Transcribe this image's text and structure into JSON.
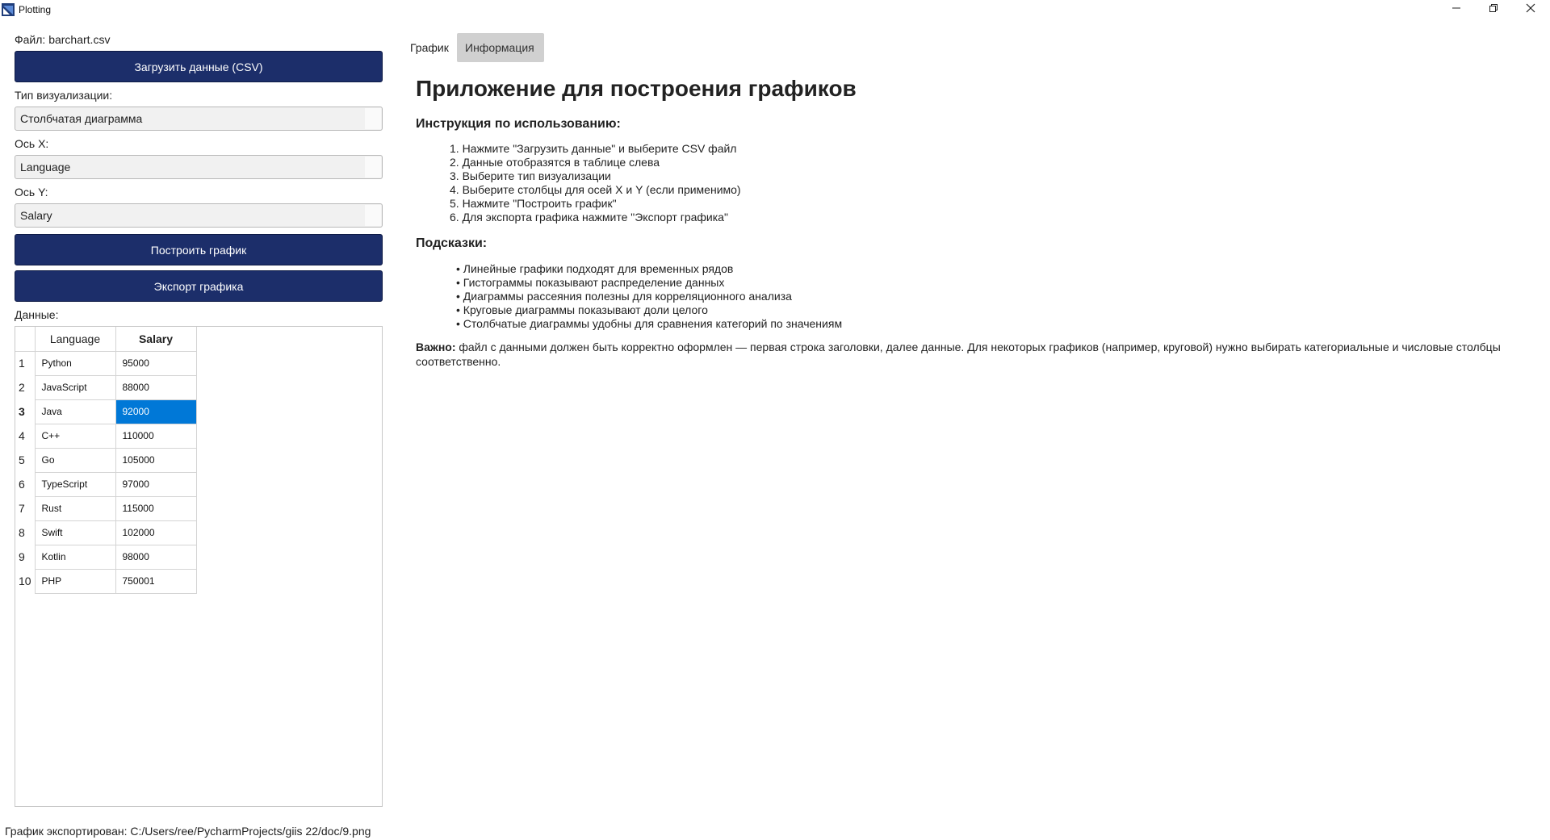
{
  "window": {
    "title": "Plotting"
  },
  "left": {
    "file_label": "Файл: barchart.csv",
    "load_button": "Загрузить данные (CSV)",
    "vis_type_label": "Тип визуализации:",
    "vis_type_value": "Столбчатая диаграмма",
    "x_axis_label": "Ось X:",
    "x_axis_value": "Language",
    "y_axis_label": "Ось Y:",
    "y_axis_value": "Salary",
    "plot_button": "Построить график",
    "export_button": "Экспорт графика",
    "data_label": "Данные:"
  },
  "table": {
    "columns": [
      "Language",
      "Salary"
    ],
    "rows": [
      {
        "n": "1",
        "language": "Python",
        "salary": "95000"
      },
      {
        "n": "2",
        "language": "JavaScript",
        "salary": "88000"
      },
      {
        "n": "3",
        "language": "Java",
        "salary": "92000"
      },
      {
        "n": "4",
        "language": "C++",
        "salary": "110000"
      },
      {
        "n": "5",
        "language": "Go",
        "salary": "105000"
      },
      {
        "n": "6",
        "language": "TypeScript",
        "salary": "97000"
      },
      {
        "n": "7",
        "language": "Rust",
        "salary": "115000"
      },
      {
        "n": "8",
        "language": "Swift",
        "salary": "102000"
      },
      {
        "n": "9",
        "language": "Kotlin",
        "salary": "98000"
      },
      {
        "n": "10",
        "language": "PHP",
        "salary": "750001"
      }
    ],
    "selected_row": 3
  },
  "status": "График экспортирован: C:/Users/ree/PycharmProjects/giis 22/doc/9.png",
  "tabs": {
    "graph": "График",
    "info": "Информация"
  },
  "info": {
    "title": "Приложение для построения графиков",
    "instructions_heading": "Инструкция по использованию:",
    "instructions": [
      "1. Нажмите \"Загрузить данные\" и выберите CSV файл",
      "2. Данные отобразятся в таблице слева",
      "3. Выберите тип визуализации",
      "4. Выберите столбцы для осей X и Y (если применимо)",
      "5. Нажмите \"Построить график\"",
      "6. Для экспорта графика нажмите \"Экспорт графика\""
    ],
    "tips_heading": "Подсказки:",
    "tips": [
      "• Линейные графики подходят для временных рядов",
      "• Гистограммы показывают распределение данных",
      "• Диаграммы рассеяния полезны для корреляционного анализа",
      "• Круговые диаграммы показывают доли целого",
      "• Столбчатые диаграммы удобны для сравнения категорий по значениям"
    ],
    "note_bold": "Важно:",
    "note_text": " файл с данными должен быть корректно оформлен — первая строка заголовки, далее данные. Для некоторых графиков (например, круговой) нужно выбирать категориальные и числовые столбцы соответственно."
  },
  "colors": {
    "primary_button": "#1c2e6a",
    "selection": "#0078d7",
    "active_tab": "#d0d0d0"
  }
}
